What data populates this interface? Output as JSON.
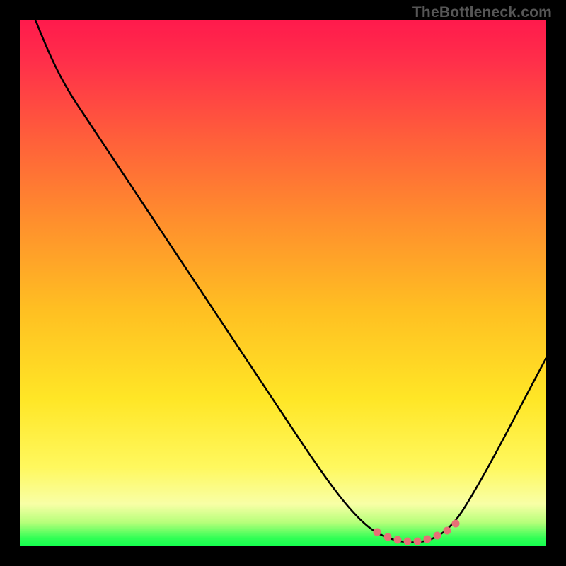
{
  "watermark": "TheBottleneck.com",
  "colors": {
    "bg": "#000000",
    "grad_top": "#ff1a4c",
    "grad_mid1": "#ff7a2b",
    "grad_mid2": "#ffd21f",
    "grad_mid3": "#fff766",
    "grad_bottom": "#15ff4f",
    "curve": "#000000",
    "dots": "#e67076",
    "watermark": "#565656"
  },
  "chart_data": {
    "type": "line",
    "title": "",
    "xlabel": "",
    "ylabel": "",
    "xlim": [
      0,
      100
    ],
    "ylim": [
      0,
      100
    ],
    "series": [
      {
        "name": "curve",
        "x": [
          3,
          8,
          15,
          25,
          35,
          45,
          55,
          62,
          66,
          70,
          74,
          78,
          82,
          85,
          90,
          95,
          100
        ],
        "y": [
          100,
          93,
          82,
          67,
          52,
          37,
          22,
          12,
          6,
          2,
          0.5,
          0.5,
          2,
          6,
          14,
          24,
          36
        ]
      }
    ],
    "flat_region_x": [
      69,
      82
    ],
    "dots": {
      "x": [
        69,
        70.8,
        72.5,
        74.2,
        76,
        77.8,
        79.5,
        81.3,
        82.5
      ],
      "y": [
        2.2,
        1.3,
        0.8,
        0.6,
        0.6,
        0.8,
        1.3,
        2.2,
        3.6
      ]
    }
  }
}
